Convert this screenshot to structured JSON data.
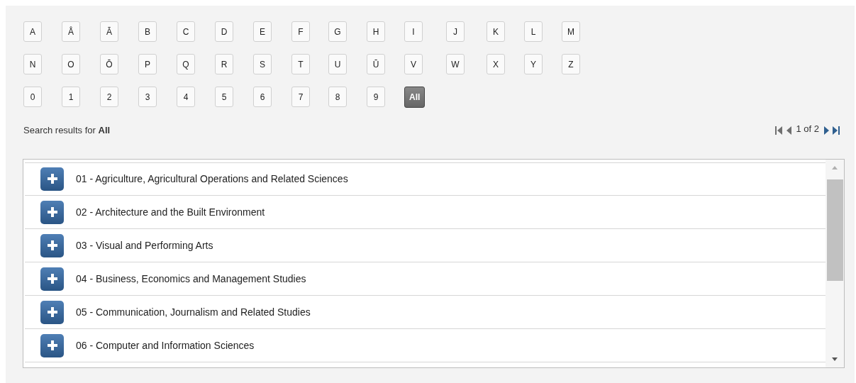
{
  "letter_rows": [
    [
      {
        "label": "A",
        "selected": false
      },
      {
        "label": "Å",
        "selected": false
      },
      {
        "label": "Ā",
        "selected": false
      },
      {
        "label": "B",
        "selected": false
      },
      {
        "label": "C",
        "selected": false
      },
      {
        "label": "D",
        "selected": false
      },
      {
        "label": "E",
        "selected": false
      },
      {
        "label": "F",
        "selected": false
      },
      {
        "label": "G",
        "selected": false
      },
      {
        "label": "H",
        "selected": false
      },
      {
        "label": "I",
        "selected": false
      },
      {
        "label": "J",
        "selected": false
      },
      {
        "label": "K",
        "selected": false
      },
      {
        "label": "L",
        "selected": false
      },
      {
        "label": "M",
        "selected": false
      }
    ],
    [
      {
        "label": "N",
        "selected": false
      },
      {
        "label": "O",
        "selected": false
      },
      {
        "label": "Ō",
        "selected": false
      },
      {
        "label": "P",
        "selected": false
      },
      {
        "label": "Q",
        "selected": false
      },
      {
        "label": "R",
        "selected": false
      },
      {
        "label": "S",
        "selected": false
      },
      {
        "label": "T",
        "selected": false
      },
      {
        "label": "U",
        "selected": false
      },
      {
        "label": "Ū",
        "selected": false
      },
      {
        "label": "V",
        "selected": false
      },
      {
        "label": "W",
        "selected": false
      },
      {
        "label": "X",
        "selected": false
      },
      {
        "label": "Y",
        "selected": false
      },
      {
        "label": "Z",
        "selected": false
      }
    ],
    [
      {
        "label": "0",
        "selected": false
      },
      {
        "label": "1",
        "selected": false
      },
      {
        "label": "2",
        "selected": false
      },
      {
        "label": "3",
        "selected": false
      },
      {
        "label": "4",
        "selected": false
      },
      {
        "label": "5",
        "selected": false
      },
      {
        "label": "6",
        "selected": false
      },
      {
        "label": "7",
        "selected": false
      },
      {
        "label": "8",
        "selected": false
      },
      {
        "label": "9",
        "selected": false
      },
      {
        "label": "All",
        "selected": true
      }
    ]
  ],
  "search_caption": "Search results for **All**",
  "pager": {
    "first": {
      "disabled": true
    },
    "previous": {
      "disabled": true
    },
    "page_text": "1 of 2",
    "next": {
      "disabled": false
    },
    "last": {
      "disabled": false
    }
  },
  "results": [
    {
      "label": "01 - Agriculture, Agricultural Operations and Related Sciences",
      "expanded": false
    },
    {
      "label": "02 - Architecture and the Built Environment",
      "expanded": false
    },
    {
      "label": "03 - Visual and Performing Arts",
      "expanded": false
    },
    {
      "label": "04 - Business, Economics and Management Studies",
      "expanded": false
    },
    {
      "label": "05 - Communication, Journalism and Related Studies",
      "expanded": false
    },
    {
      "label": "06 - Computer and Information Sciences",
      "expanded": false
    }
  ]
}
